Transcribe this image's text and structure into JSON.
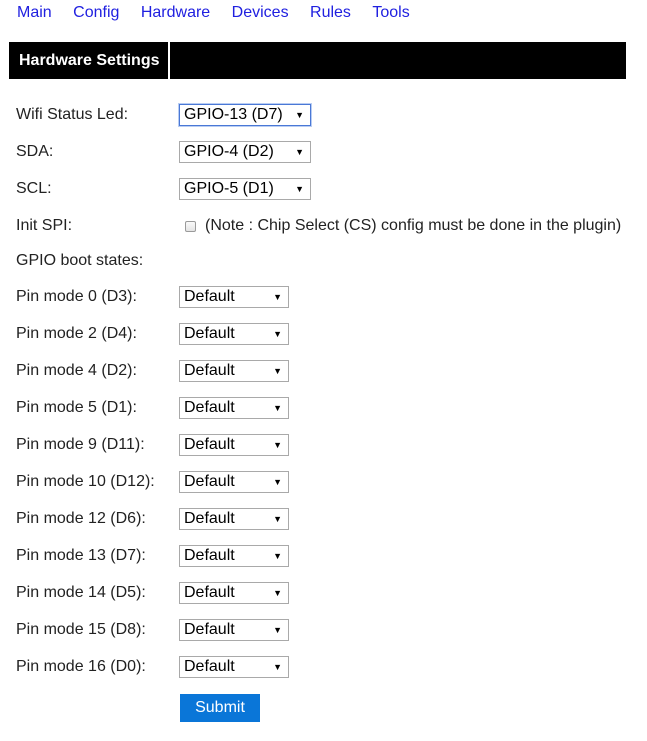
{
  "nav": {
    "items": [
      {
        "label": "Main"
      },
      {
        "label": "Config"
      },
      {
        "label": "Hardware"
      },
      {
        "label": "Devices"
      },
      {
        "label": "Rules"
      },
      {
        "label": "Tools"
      }
    ]
  },
  "header": {
    "title": "Hardware Settings"
  },
  "settings": {
    "wifi_led": {
      "label": "Wifi Status Led:",
      "value": "GPIO-13 (D7)"
    },
    "sda": {
      "label": "SDA:",
      "value": "GPIO-4 (D2)"
    },
    "scl": {
      "label": "SCL:",
      "value": "GPIO-5 (D1)"
    },
    "init_spi": {
      "label": "Init SPI:",
      "checked": false,
      "note": "(Note : Chip Select (CS) config must be done in the plugin)"
    },
    "gpio_boot_states_label": "GPIO boot states:"
  },
  "pin_modes": [
    {
      "label": "Pin mode 0 (D3):",
      "value": "Default"
    },
    {
      "label": "Pin mode 2 (D4):",
      "value": "Default"
    },
    {
      "label": "Pin mode 4 (D2):",
      "value": "Default"
    },
    {
      "label": "Pin mode 5 (D1):",
      "value": "Default"
    },
    {
      "label": "Pin mode 9 (D11):",
      "value": "Default"
    },
    {
      "label": "Pin mode 10 (D12):",
      "value": "Default"
    },
    {
      "label": "Pin mode 12 (D6):",
      "value": "Default"
    },
    {
      "label": "Pin mode 13 (D7):",
      "value": "Default"
    },
    {
      "label": "Pin mode 14 (D5):",
      "value": "Default"
    },
    {
      "label": "Pin mode 15 (D8):",
      "value": "Default"
    },
    {
      "label": "Pin mode 16 (D0):",
      "value": "Default"
    }
  ],
  "icons": {
    "caret": "▼"
  },
  "submit": {
    "label": "Submit"
  },
  "colors": {
    "link": "#2020e0",
    "header_bg": "#000000",
    "submit_bg": "#0a76d8"
  }
}
